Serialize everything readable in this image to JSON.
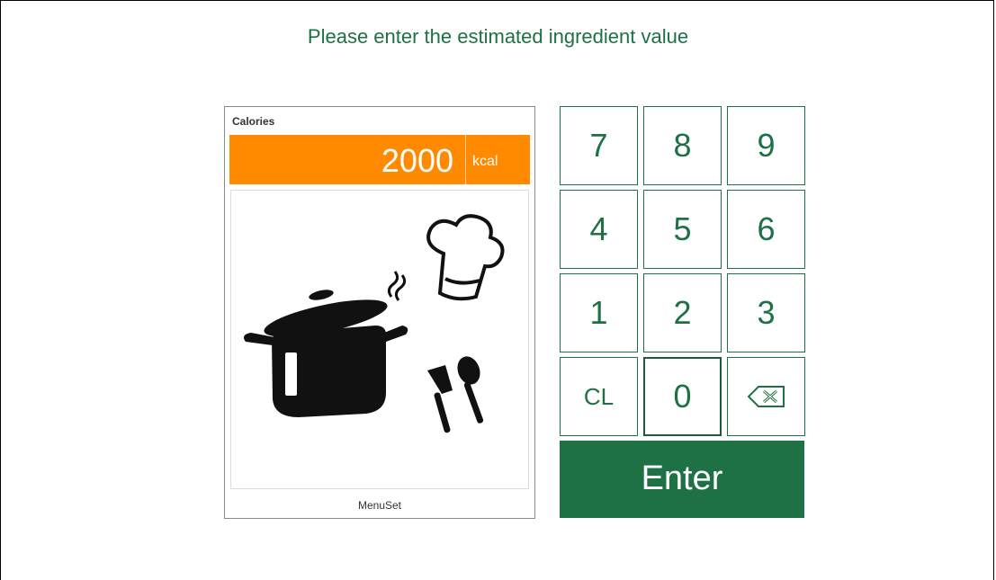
{
  "page": {
    "title": "Please enter the estimated ingredient value"
  },
  "ingredient": {
    "label": "Calories",
    "value": "2000",
    "unit": "kcal",
    "caption": "MenuSet",
    "illustration": "cooking-pot-chef-hat-utensils-icon"
  },
  "keypad": {
    "k7": "7",
    "k8": "8",
    "k9": "9",
    "k4": "4",
    "k5": "5",
    "k6": "6",
    "k1": "1",
    "k2": "2",
    "k3": "3",
    "clear": "CL",
    "k0": "0",
    "backspace_icon": "backspace-icon",
    "enter": "Enter"
  },
  "colors": {
    "accent_green": "#1e7145",
    "value_bar_orange": "#ff8a00",
    "background": "#ffffff"
  }
}
